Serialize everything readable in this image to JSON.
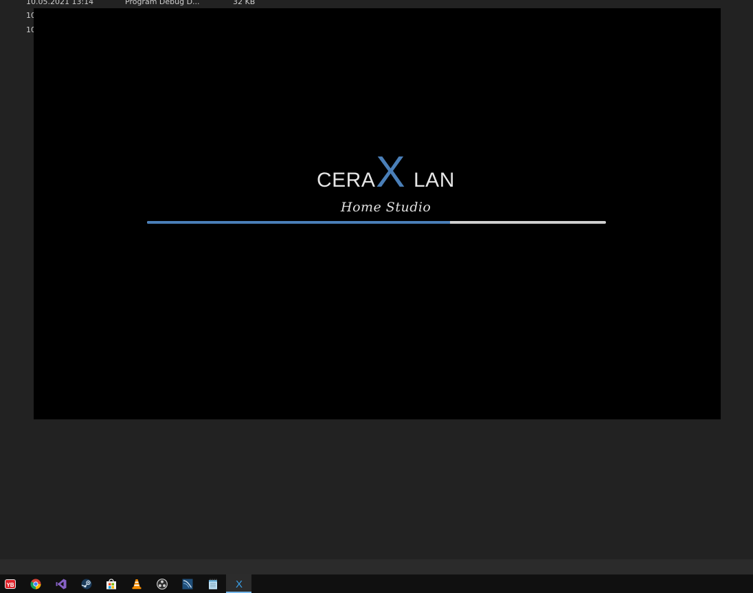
{
  "background_list": {
    "rows": [
      {
        "date": "10.05.2021 13:14",
        "type": "Program Debug D...",
        "size": "32 KB"
      },
      {
        "date": "10",
        "type": "",
        "size": ""
      },
      {
        "date": "10",
        "type": "",
        "size": ""
      }
    ]
  },
  "splash": {
    "logo_left": "CERA",
    "logo_mark": "X",
    "logo_right": "LAN",
    "subtitle": "Home Studio",
    "progress": 0.66,
    "accent": "#4a7fb8"
  },
  "taskbar": {
    "icons": [
      {
        "name": "yandex-browser-icon",
        "label": "YB"
      },
      {
        "name": "chrome-icon"
      },
      {
        "name": "visual-studio-icon"
      },
      {
        "name": "steam-icon"
      },
      {
        "name": "microsoft-store-icon"
      },
      {
        "name": "vlc-icon"
      },
      {
        "name": "obs-icon"
      },
      {
        "name": "sql-server-icon"
      },
      {
        "name": "notepad-icon"
      },
      {
        "name": "ceraxlan-icon",
        "label": "X",
        "active": true
      }
    ]
  }
}
